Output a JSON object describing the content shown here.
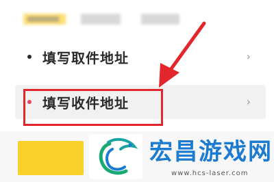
{
  "address_options": [
    {
      "label": "填写取件地址",
      "chevron": "›"
    },
    {
      "label": "填写收件地址",
      "chevron": "›"
    }
  ],
  "watermark": {
    "title": "宏昌游戏网",
    "url": "www.hcs-laser.com"
  },
  "colors": {
    "highlight": "#e3252c",
    "accent_yellow": "#f9cf2a",
    "watermark_blue": "#1a7bd0"
  },
  "icons": {
    "arrow": "annotation-arrow-icon",
    "chevron": "chevron-right-icon",
    "logo": "dragon-logo-icon"
  }
}
